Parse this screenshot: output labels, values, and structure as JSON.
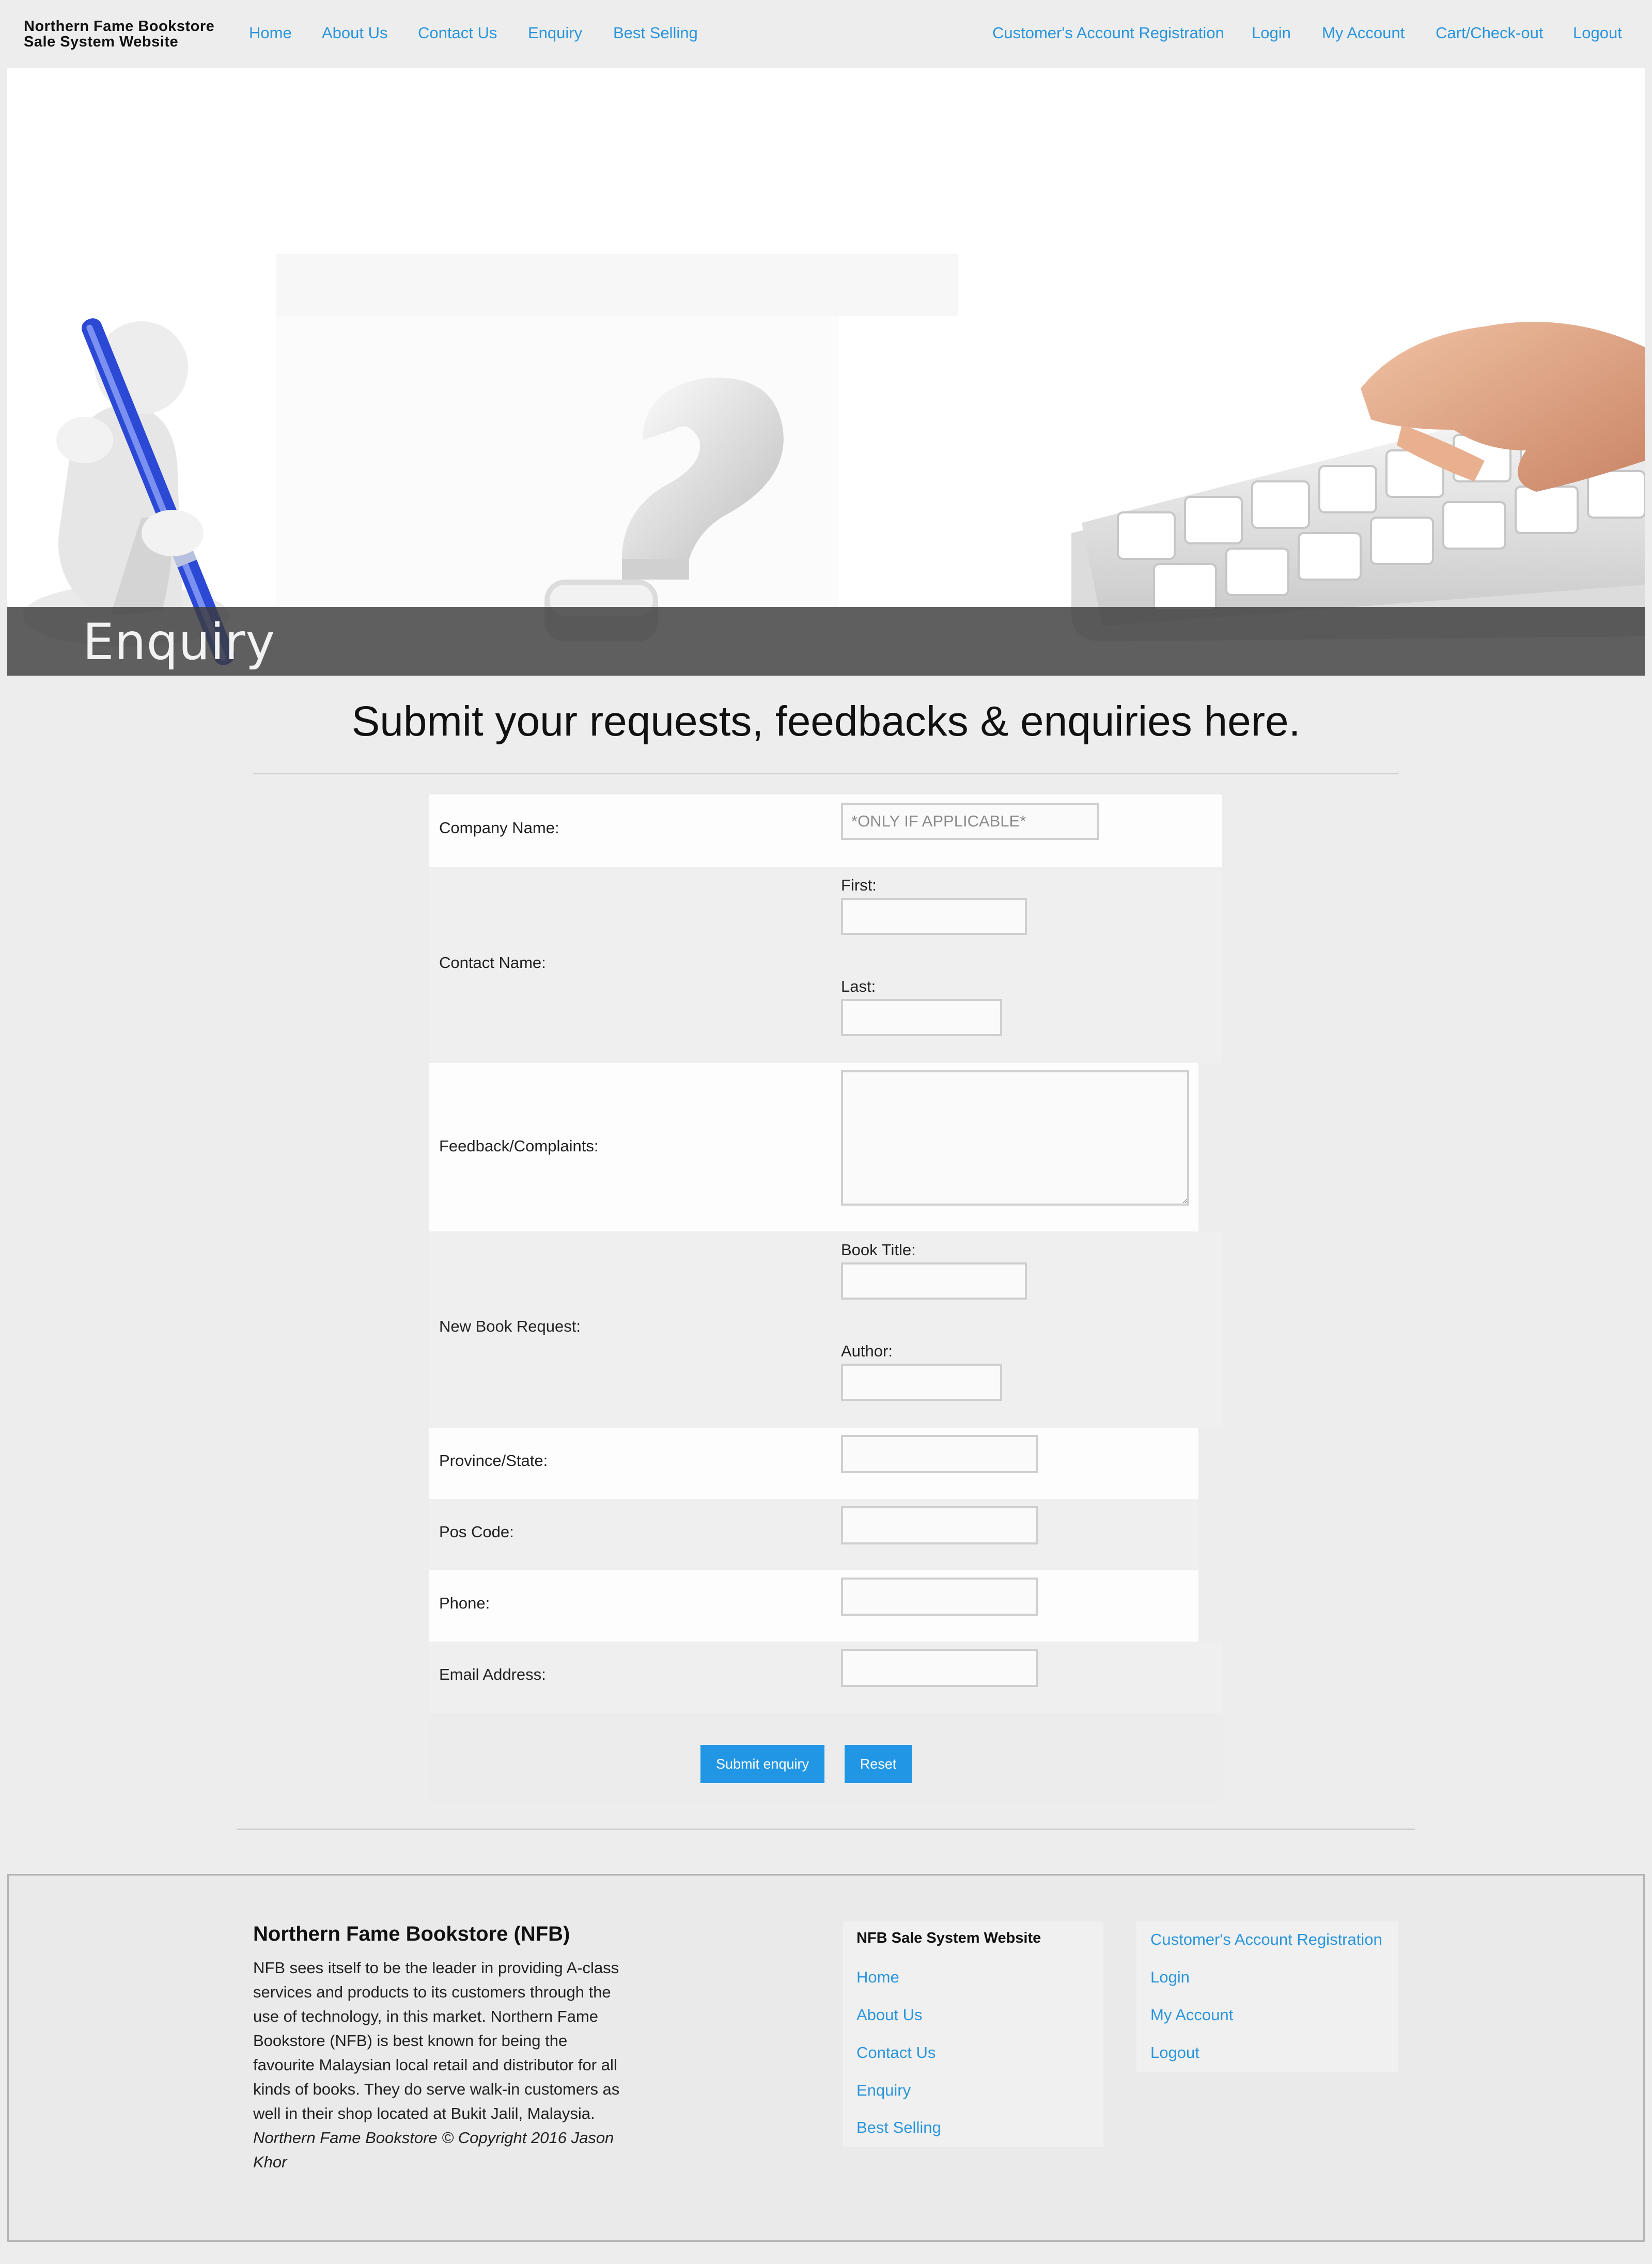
{
  "nav": {
    "brand_line1": "Northern Fame Bookstore",
    "brand_line2": "Sale System Website",
    "left_links": [
      "Home",
      "About Us",
      "Contact Us",
      "Enquiry",
      "Best Selling"
    ],
    "right_links": [
      "Customer's Account Registration",
      "Login",
      "My Account",
      "Cart/Check-out",
      "Logout"
    ]
  },
  "hero": {
    "title": "Enquiry"
  },
  "main": {
    "heading": "Submit your requests, feedbacks & enquiries here."
  },
  "form": {
    "company_label": "Company Name:",
    "company_placeholder": "*ONLY IF APPLICABLE*",
    "contact_label": "Contact Name:",
    "first_label": "First:",
    "last_label": "Last:",
    "feedback_label": "Feedback/Complaints:",
    "book_request_label": "New Book Request:",
    "book_title_label": "Book Title:",
    "author_label": "Author:",
    "province_label": "Province/State:",
    "pos_label": "Pos Code:",
    "phone_label": "Phone:",
    "email_label": "Email Address:",
    "submit_label": "Submit enquiry",
    "reset_label": "Reset"
  },
  "footer": {
    "title": "Northern Fame Bookstore (NFB)",
    "description": "NFB sees itself to be the leader in providing A-class services and products to its customers through the use of technology, in this market. Northern Fame Bookstore (NFB) is best known for being the favourite Malaysian local retail and distributor for all kinds of books. They do serve walk-in customers as well in their shop located at Bukit Jalil, Malaysia.",
    "copyright": "Northern Fame Bookstore © Copyright 2016 Jason Khor",
    "col1_heading": "NFB Sale System Website",
    "col1_links": [
      "Home",
      "About Us",
      "Contact Us",
      "Enquiry",
      "Best Selling"
    ],
    "col2_links": [
      "Customer's Account Registration",
      "Login",
      "My Account",
      "Logout"
    ]
  },
  "colors": {
    "link": "#2a95dc",
    "button": "#2196e4",
    "page_background": "#ededed"
  }
}
